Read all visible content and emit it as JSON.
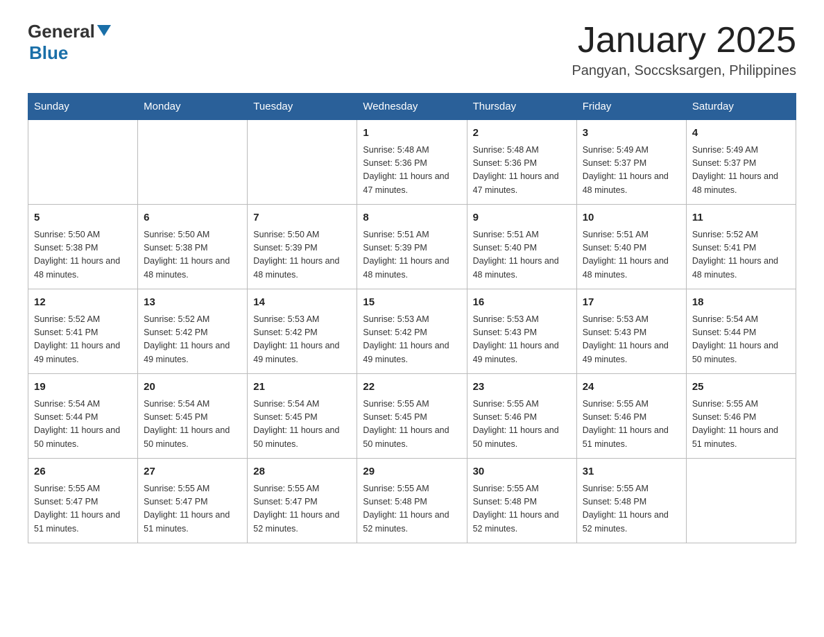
{
  "header": {
    "logo_general": "General",
    "logo_blue": "Blue",
    "month_title": "January 2025",
    "location": "Pangyan, Soccsksargen, Philippines"
  },
  "days_of_week": [
    "Sunday",
    "Monday",
    "Tuesday",
    "Wednesday",
    "Thursday",
    "Friday",
    "Saturday"
  ],
  "weeks": [
    [
      {
        "day": "",
        "info": ""
      },
      {
        "day": "",
        "info": ""
      },
      {
        "day": "",
        "info": ""
      },
      {
        "day": "1",
        "info": "Sunrise: 5:48 AM\nSunset: 5:36 PM\nDaylight: 11 hours and 47 minutes."
      },
      {
        "day": "2",
        "info": "Sunrise: 5:48 AM\nSunset: 5:36 PM\nDaylight: 11 hours and 47 minutes."
      },
      {
        "day": "3",
        "info": "Sunrise: 5:49 AM\nSunset: 5:37 PM\nDaylight: 11 hours and 48 minutes."
      },
      {
        "day": "4",
        "info": "Sunrise: 5:49 AM\nSunset: 5:37 PM\nDaylight: 11 hours and 48 minutes."
      }
    ],
    [
      {
        "day": "5",
        "info": "Sunrise: 5:50 AM\nSunset: 5:38 PM\nDaylight: 11 hours and 48 minutes."
      },
      {
        "day": "6",
        "info": "Sunrise: 5:50 AM\nSunset: 5:38 PM\nDaylight: 11 hours and 48 minutes."
      },
      {
        "day": "7",
        "info": "Sunrise: 5:50 AM\nSunset: 5:39 PM\nDaylight: 11 hours and 48 minutes."
      },
      {
        "day": "8",
        "info": "Sunrise: 5:51 AM\nSunset: 5:39 PM\nDaylight: 11 hours and 48 minutes."
      },
      {
        "day": "9",
        "info": "Sunrise: 5:51 AM\nSunset: 5:40 PM\nDaylight: 11 hours and 48 minutes."
      },
      {
        "day": "10",
        "info": "Sunrise: 5:51 AM\nSunset: 5:40 PM\nDaylight: 11 hours and 48 minutes."
      },
      {
        "day": "11",
        "info": "Sunrise: 5:52 AM\nSunset: 5:41 PM\nDaylight: 11 hours and 48 minutes."
      }
    ],
    [
      {
        "day": "12",
        "info": "Sunrise: 5:52 AM\nSunset: 5:41 PM\nDaylight: 11 hours and 49 minutes."
      },
      {
        "day": "13",
        "info": "Sunrise: 5:52 AM\nSunset: 5:42 PM\nDaylight: 11 hours and 49 minutes."
      },
      {
        "day": "14",
        "info": "Sunrise: 5:53 AM\nSunset: 5:42 PM\nDaylight: 11 hours and 49 minutes."
      },
      {
        "day": "15",
        "info": "Sunrise: 5:53 AM\nSunset: 5:42 PM\nDaylight: 11 hours and 49 minutes."
      },
      {
        "day": "16",
        "info": "Sunrise: 5:53 AM\nSunset: 5:43 PM\nDaylight: 11 hours and 49 minutes."
      },
      {
        "day": "17",
        "info": "Sunrise: 5:53 AM\nSunset: 5:43 PM\nDaylight: 11 hours and 49 minutes."
      },
      {
        "day": "18",
        "info": "Sunrise: 5:54 AM\nSunset: 5:44 PM\nDaylight: 11 hours and 50 minutes."
      }
    ],
    [
      {
        "day": "19",
        "info": "Sunrise: 5:54 AM\nSunset: 5:44 PM\nDaylight: 11 hours and 50 minutes."
      },
      {
        "day": "20",
        "info": "Sunrise: 5:54 AM\nSunset: 5:45 PM\nDaylight: 11 hours and 50 minutes."
      },
      {
        "day": "21",
        "info": "Sunrise: 5:54 AM\nSunset: 5:45 PM\nDaylight: 11 hours and 50 minutes."
      },
      {
        "day": "22",
        "info": "Sunrise: 5:55 AM\nSunset: 5:45 PM\nDaylight: 11 hours and 50 minutes."
      },
      {
        "day": "23",
        "info": "Sunrise: 5:55 AM\nSunset: 5:46 PM\nDaylight: 11 hours and 50 minutes."
      },
      {
        "day": "24",
        "info": "Sunrise: 5:55 AM\nSunset: 5:46 PM\nDaylight: 11 hours and 51 minutes."
      },
      {
        "day": "25",
        "info": "Sunrise: 5:55 AM\nSunset: 5:46 PM\nDaylight: 11 hours and 51 minutes."
      }
    ],
    [
      {
        "day": "26",
        "info": "Sunrise: 5:55 AM\nSunset: 5:47 PM\nDaylight: 11 hours and 51 minutes."
      },
      {
        "day": "27",
        "info": "Sunrise: 5:55 AM\nSunset: 5:47 PM\nDaylight: 11 hours and 51 minutes."
      },
      {
        "day": "28",
        "info": "Sunrise: 5:55 AM\nSunset: 5:47 PM\nDaylight: 11 hours and 52 minutes."
      },
      {
        "day": "29",
        "info": "Sunrise: 5:55 AM\nSunset: 5:48 PM\nDaylight: 11 hours and 52 minutes."
      },
      {
        "day": "30",
        "info": "Sunrise: 5:55 AM\nSunset: 5:48 PM\nDaylight: 11 hours and 52 minutes."
      },
      {
        "day": "31",
        "info": "Sunrise: 5:55 AM\nSunset: 5:48 PM\nDaylight: 11 hours and 52 minutes."
      },
      {
        "day": "",
        "info": ""
      }
    ]
  ]
}
